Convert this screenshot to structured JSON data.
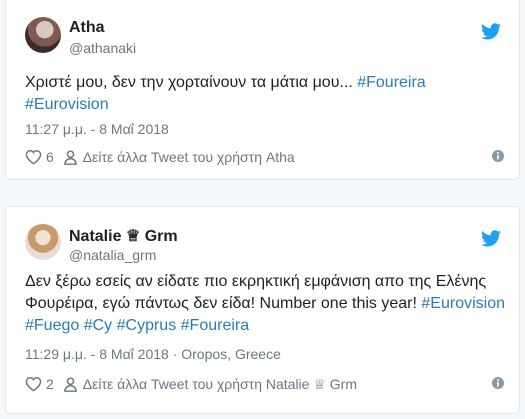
{
  "tweets": [
    {
      "name": "Atha",
      "handle": "@athanaki",
      "text_plain": "Χριστέ μου, δεν την χορταίνουν τα μάτια μου... ",
      "tags": [
        "#Foureira",
        "#Eurovision"
      ],
      "meta": "11:27 μ.μ. - 8 Μαΐ 2018",
      "likes": "6",
      "see_more": "Δείτε άλλα Tweet του χρήστη Atha"
    },
    {
      "name": "Natalie ♕ Grm",
      "handle": "@natalia_grm",
      "text_plain": "Δεν ξέρω εσείς αν είδατε πιο εκρηκτική εμφάνιση απο της Ελένης Φουρέιρα, εγώ πάντως δεν είδα! Number one this year! ",
      "tags": [
        "#Eurovision",
        "#Fuego",
        "#Cy",
        "#Cyprus",
        "#Foureira"
      ],
      "meta": "11:29 μ.μ. - 8 Μαΐ 2018 · Oropos, Greece",
      "likes": "2",
      "see_more": "Δείτε άλλα Tweet του χρήστη Natalie ♕ Grm"
    }
  ],
  "colors": {
    "link": "#2b7bb9",
    "twitter_blue": "#1da1f2",
    "muted": "#697882"
  },
  "icons": [
    "twitter-bird-icon",
    "heart-icon",
    "person-icon",
    "info-icon"
  ]
}
